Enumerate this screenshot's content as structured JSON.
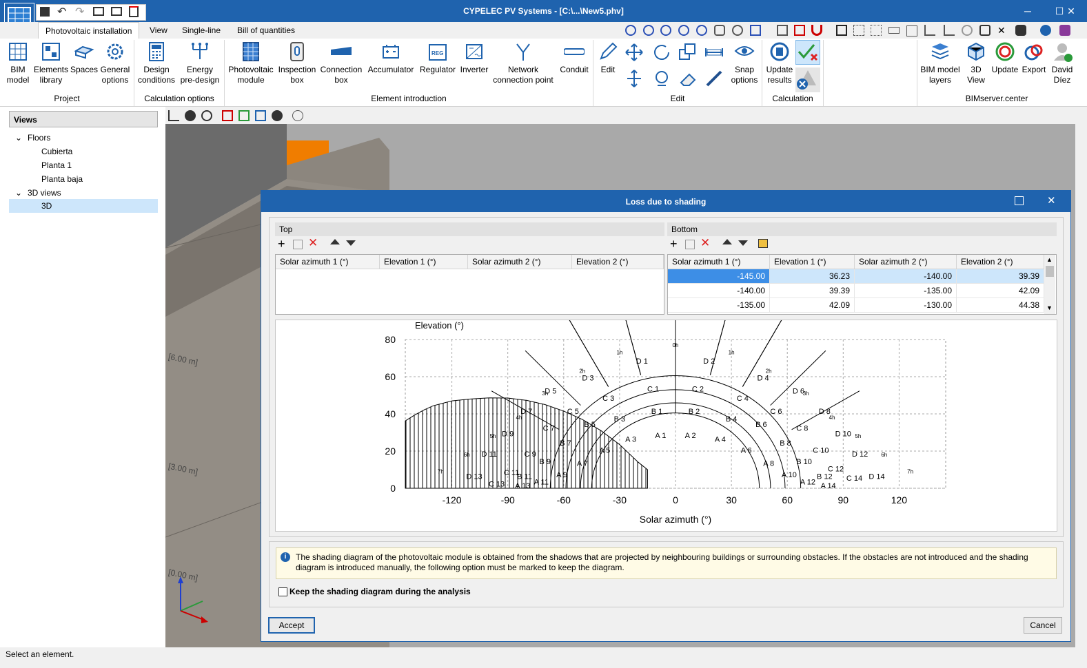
{
  "window": {
    "title": "CYPELEC PV Systems - [C:\\...\\New5.phv]",
    "minimize": "─",
    "maximize": "☐",
    "close": "✕"
  },
  "tabs": [
    "Photovoltaic installation",
    "View",
    "Single-line",
    "Bill of quantities"
  ],
  "ribbon": {
    "project": {
      "label": "Project",
      "buttons": [
        [
          "BIM",
          "model"
        ],
        [
          "Elements",
          "library"
        ],
        [
          "Spaces",
          ""
        ],
        [
          "General",
          "options"
        ]
      ]
    },
    "calc_options": {
      "label": "Calculation options",
      "buttons": [
        [
          "Design",
          "conditions"
        ],
        [
          "Energy",
          "pre-design"
        ]
      ]
    },
    "element_intro": {
      "label": "Element introduction",
      "buttons": [
        [
          "Photovoltaic",
          "module"
        ],
        [
          "Inspection",
          "box"
        ],
        [
          "Connection",
          "box"
        ],
        [
          "Accumulator",
          ""
        ],
        [
          "Regulator",
          ""
        ],
        [
          "Inverter",
          ""
        ],
        [
          "Network",
          "connection point"
        ],
        [
          "Conduit",
          ""
        ]
      ]
    },
    "edit": {
      "label": "Edit",
      "edit_button": "Edit",
      "snap": [
        "Snap",
        "options"
      ]
    },
    "calculation": {
      "label": "Calculation",
      "update": [
        "Update",
        "results"
      ]
    },
    "bimserver": {
      "label": "BIMserver.center",
      "buttons": [
        [
          "BIM model",
          "layers"
        ],
        [
          "3D",
          "View"
        ],
        [
          "Update",
          ""
        ],
        [
          "Export",
          ""
        ],
        [
          "David",
          "Díez"
        ]
      ]
    },
    "regulator_tag": "REG"
  },
  "views_panel": {
    "header": "Views",
    "floors_label": "Floors",
    "floors": [
      "Cubierta",
      "Planta 1",
      "Planta baja"
    ],
    "views3d_label": "3D views",
    "views3d": [
      "3D"
    ]
  },
  "viewport": {
    "dims": [
      "[6.00 m]",
      "[3.00 m]",
      "[0.00 m]"
    ]
  },
  "status": "Select an element.",
  "dialog": {
    "title": "Loss due to shading",
    "top": {
      "label": "Top",
      "columns": [
        "Solar azimuth 1 (°)",
        "Elevation 1 (°)",
        "Solar azimuth 2 (°)",
        "Elevation 2 (°)"
      ]
    },
    "bottom": {
      "label": "Bottom",
      "columns": [
        "Solar azimuth 1 (°)",
        "Elevation 1 (°)",
        "Solar azimuth 2 (°)",
        "Elevation 2 (°)"
      ],
      "rows": [
        [
          "-145.00",
          "36.23",
          "-140.00",
          "39.39"
        ],
        [
          "-140.00",
          "39.39",
          "-135.00",
          "42.09"
        ],
        [
          "-135.00",
          "42.09",
          "-130.00",
          "44.38"
        ]
      ]
    },
    "info": "The shading diagram of the photovoltaic module is obtained from the shadows that are projected by neighbouring buildings or surrounding obstacles. If the obstacles are not introduced and the shading diagram is introduced manually, the following option must be marked to keep the diagram.",
    "keep_label": "Keep the shading diagram during the analysis",
    "keep_checked": false,
    "accept": "Accept",
    "cancel": "Cancel"
  },
  "chart_data": {
    "type": "area",
    "title": "",
    "xlabel": "Solar azimuth (°)",
    "ylabel": "Elevation (°)",
    "xlim": [
      -145,
      145
    ],
    "ylim": [
      0,
      80
    ],
    "xticks": [
      -120,
      -90,
      -60,
      -30,
      0,
      30,
      60,
      90,
      120
    ],
    "yticks": [
      0,
      20,
      40,
      60,
      80
    ],
    "grid": true,
    "shaded_obstacle_profile": {
      "x": [
        -145,
        -140,
        -135,
        -130,
        -120,
        -110,
        -100,
        -90,
        -80,
        -70,
        -60,
        -50,
        -40,
        -30,
        -20,
        -15
      ],
      "y": [
        36.23,
        39.39,
        42.09,
        44.38,
        47,
        48,
        48.6,
        48.5,
        47.3,
        45,
        41.5,
        37,
        31,
        23.5,
        14,
        10
      ]
    },
    "hour_labels": [
      "7h",
      "6h",
      "5h",
      "4h",
      "3h",
      "2h",
      "1h",
      "0h",
      "1h",
      "2h",
      "3h",
      "4h",
      "5h",
      "6h",
      "7h"
    ],
    "sector_labels": {
      "D": [
        "D 1",
        "D 2",
        "D 3",
        "D 4",
        "D 5",
        "D 6",
        "D 7",
        "D 8",
        "D 9",
        "D 10",
        "D 11",
        "D 12",
        "D 13",
        "D 14"
      ],
      "C": [
        "C 1",
        "C 2",
        "C 3",
        "C 4",
        "C 5",
        "C 6",
        "C 7",
        "C 8",
        "C 9",
        "C 10",
        "C 11",
        "C 12",
        "C 13",
        "C 14"
      ],
      "B": [
        "B 1",
        "B 2",
        "B 3",
        "B 4",
        "B 5",
        "B 6",
        "B 7",
        "B 8",
        "B 9",
        "B 10",
        "B 11",
        "B 12"
      ],
      "A": [
        "A 1",
        "A 2",
        "A 3",
        "A 4",
        "A 5",
        "A 6",
        "A 7",
        "A 8",
        "A 9",
        "A 10",
        "A 11",
        "A 12",
        "A 13",
        "A 14"
      ]
    }
  },
  "colors": {
    "title_bar": "#1f63ae",
    "selection": "#3d8ee6",
    "orange_block": "#f07d00",
    "building": "#908a82"
  }
}
